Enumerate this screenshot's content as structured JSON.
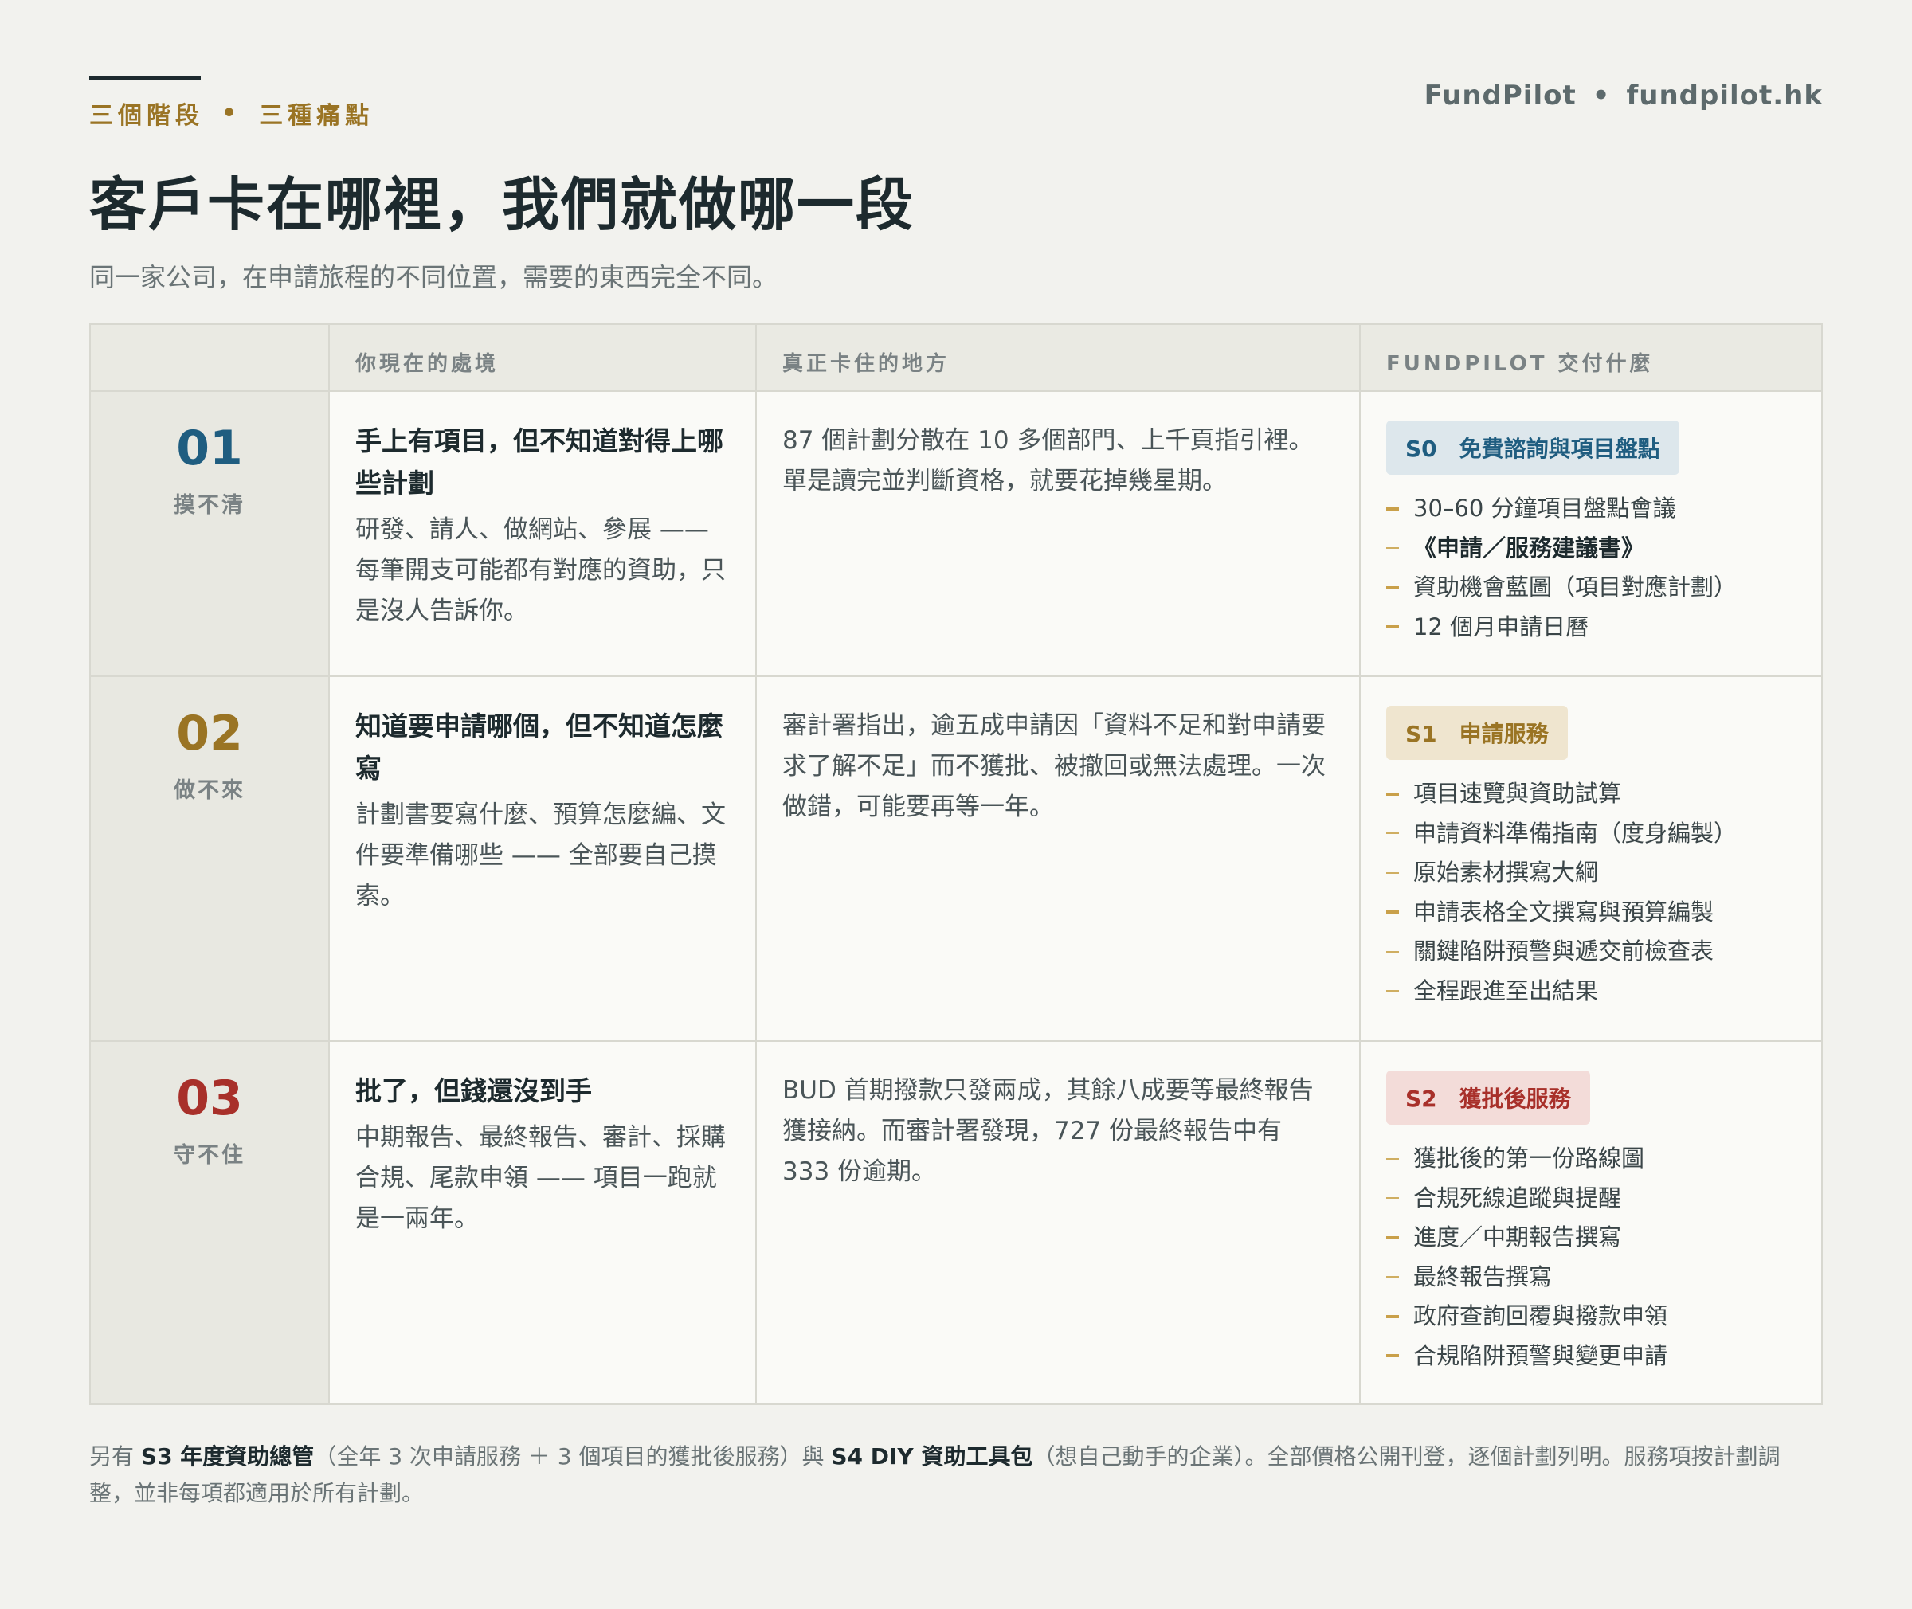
{
  "header": {
    "kicker_left": "三個階段",
    "kicker_right": "三種痛點",
    "brand_name": "FundPilot",
    "brand_url": "fundpilot.hk",
    "title": "客戶卡在哪裡，我們就做哪一段",
    "subtitle": "同一家公司，在申請旅程的不同位置，需要的東西完全不同。"
  },
  "table": {
    "columns": [
      "",
      "你現在的處境",
      "真正卡住的地方",
      "FUNDPILOT 交付什麼"
    ],
    "rows": [
      {
        "num": "01",
        "stage": "摸不清",
        "situation_title": "手上有項目，但不知道對得上哪些計劃",
        "situation_body": "研發、請人、做網站、參展 —— 每筆開支可能都有對應的資助，只是沒人告訴你。",
        "pain": "87 個計劃分散在 10 多個部門、上千頁指引裡。單是讀完並判斷資格，就要花掉幾星期。",
        "badge_code": "S0",
        "badge_label": "免費諮詢與項目盤點",
        "items": [
          {
            "text": "30–60 分鐘項目盤點會議",
            "strong": false,
            "thick": true
          },
          {
            "text": "《申請／服務建議書》",
            "strong": true,
            "thick": false
          },
          {
            "text": "資助機會藍圖（項目對應計劃）",
            "strong": false,
            "thick": true
          },
          {
            "text": "12 個月申請日曆",
            "strong": false,
            "thick": true
          }
        ]
      },
      {
        "num": "02",
        "stage": "做不來",
        "situation_title": "知道要申請哪個，但不知道怎麼寫",
        "situation_body": "計劃書要寫什麼、預算怎麼編、文件要準備哪些 —— 全部要自己摸索。",
        "pain": "審計署指出，逾五成申請因「資料不足和對申請要求了解不足」而不獲批、被撤回或無法處理。一次做錯，可能要再等一年。",
        "badge_code": "S1",
        "badge_label": "申請服務",
        "items": [
          {
            "text": "項目速覽與資助試算",
            "strong": false,
            "thick": true
          },
          {
            "text": "申請資料準備指南（度身編製）",
            "strong": false,
            "thick": false
          },
          {
            "text": "原始素材撰寫大綱",
            "strong": false,
            "thick": false
          },
          {
            "text": "申請表格全文撰寫與預算編製",
            "strong": false,
            "thick": true
          },
          {
            "text": "關鍵陷阱預警與遞交前檢查表",
            "strong": false,
            "thick": false
          },
          {
            "text": "全程跟進至出結果",
            "strong": false,
            "thick": false
          }
        ]
      },
      {
        "num": "03",
        "stage": "守不住",
        "situation_title": "批了，但錢還沒到手",
        "situation_body": "中期報告、最終報告、審計、採購合規、尾款申領 —— 項目一跑就是一兩年。",
        "pain": "BUD 首期撥款只發兩成，其餘八成要等最終報告獲接納。而審計署發現，727 份最終報告中有 333 份逾期。",
        "badge_code": "S2",
        "badge_label": "獲批後服務",
        "items": [
          {
            "text": "獲批後的第一份路線圖",
            "strong": false,
            "thick": false
          },
          {
            "text": "合規死線追蹤與提醒",
            "strong": false,
            "thick": false
          },
          {
            "text": "進度／中期報告撰寫",
            "strong": false,
            "thick": true
          },
          {
            "text": "最終報告撰寫",
            "strong": false,
            "thick": false
          },
          {
            "text": "政府查詢回覆與撥款申領",
            "strong": false,
            "thick": true
          },
          {
            "text": "合規陷阱預警與變更申請",
            "strong": false,
            "thick": true
          }
        ]
      }
    ]
  },
  "footnote": {
    "prefix": "另有 ",
    "s3": "S3 年度資助總管",
    "s3_desc": "（全年 3 次申請服務 ＋ 3 個項目的獲批後服務）與 ",
    "s4": "S4 DIY 資助工具包",
    "s4_desc": "（想自己動手的企業）。全部價格公開刊登，逐個計劃列明。服務項按計劃調整，並非每項都適用於所有計劃。"
  },
  "colors": {
    "stage_01": "#1f5d80",
    "stage_02": "#9a7424",
    "stage_03": "#a8302a",
    "accent_gold": "#9a7424"
  }
}
